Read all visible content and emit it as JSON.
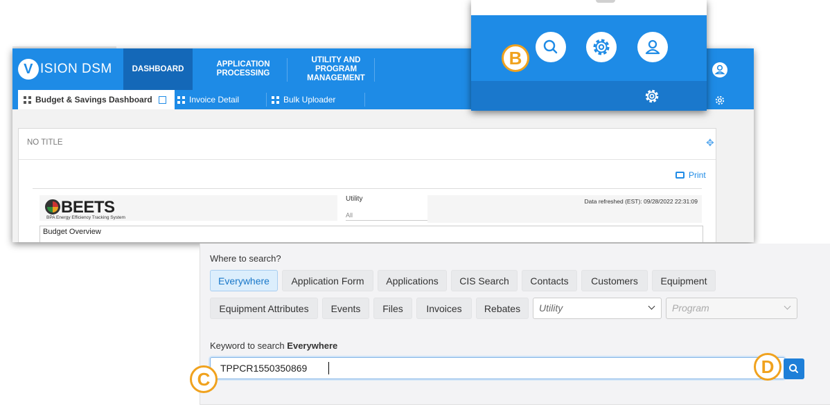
{
  "app": {
    "logo_text": "ISION DSM",
    "logo_letter": "V"
  },
  "nav": {
    "tabs": [
      {
        "label": "DASHBOARD"
      },
      {
        "label": "APPLICATION PROCESSING"
      },
      {
        "label": "UTILITY AND PROGRAM MANAGEMENT"
      }
    ]
  },
  "subnav": {
    "tabs": [
      {
        "label": "Budget & Savings Dashboard"
      },
      {
        "label": "Invoice Detail"
      },
      {
        "label": "Bulk Uploader"
      }
    ]
  },
  "card": {
    "title": "NO TITLE",
    "print_label": "Print",
    "beets_logo": "BEETS",
    "beets_subtitle": "BPA Energy Efficiency Tracking System",
    "utility_label": "Utility",
    "utility_value": "All",
    "refresh_text": "Data refreshed (EST): 09/28/2022 22:31:09",
    "budget_overview": "Budget Overview"
  },
  "callouts": {
    "b": "B",
    "c": "C",
    "d": "D"
  },
  "search": {
    "where_label": "Where to search?",
    "scopes": [
      {
        "label": "Everywhere",
        "active": true
      },
      {
        "label": "Application Form"
      },
      {
        "label": "Applications"
      },
      {
        "label": "CIS Search"
      },
      {
        "label": "Contacts"
      },
      {
        "label": "Customers"
      },
      {
        "label": "Equipment"
      },
      {
        "label": "Equipment Attributes"
      },
      {
        "label": "Events"
      },
      {
        "label": "Files"
      },
      {
        "label": "Invoices"
      },
      {
        "label": "Rebates"
      }
    ],
    "utility_placeholder": "Utility",
    "program_placeholder": "Program",
    "keyword_prefix": "Keyword to search",
    "keyword_scope": "Everywhere",
    "keyword_value": "TPPCR1550350869"
  },
  "colors": {
    "primary": "#1e8be6",
    "active_tab": "#1468b8",
    "callout": "#f0a21e",
    "search_button": "#1e7fd8"
  },
  "icons": [
    "search-icon",
    "gear-icon",
    "user-icon",
    "grid-icon",
    "external-link-icon",
    "print-icon",
    "move-icon",
    "chevron-down-icon"
  ]
}
